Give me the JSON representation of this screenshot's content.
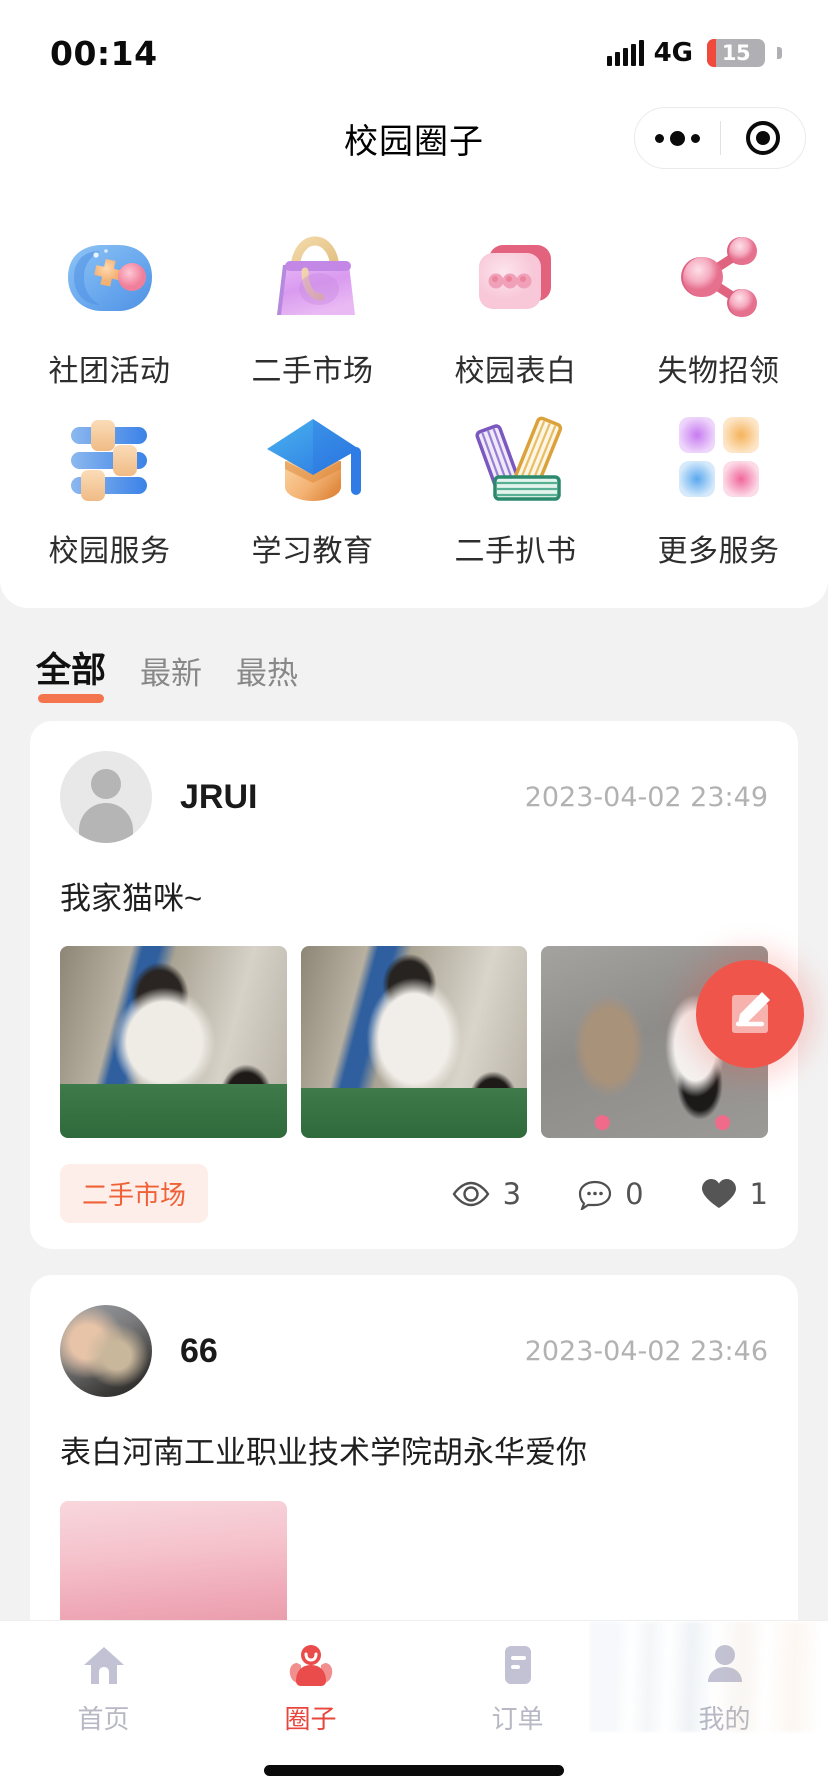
{
  "status_bar": {
    "time": "00:14",
    "network": "4G",
    "battery_level": "15",
    "signal_icon": "signal-bars-icon",
    "battery_icon": "battery-icon"
  },
  "nav": {
    "title": "校园圈子",
    "more_icon": "more-dots-icon",
    "target_icon": "target-circle-icon"
  },
  "grid": {
    "rows": [
      [
        {
          "label": "社团活动",
          "icon": "gamepad-icon"
        },
        {
          "label": "二手市场",
          "icon": "handbag-icon"
        },
        {
          "label": "校园表白",
          "icon": "chat-bubble-icon"
        },
        {
          "label": "失物招领",
          "icon": "share-nodes-icon"
        }
      ],
      [
        {
          "label": "校园服务",
          "icon": "sliders-icon"
        },
        {
          "label": "学习教育",
          "icon": "graduation-cap-icon"
        },
        {
          "label": "二手扒书",
          "icon": "books-icon"
        },
        {
          "label": "更多服务",
          "icon": "grid-squares-icon"
        }
      ]
    ]
  },
  "filter_tabs": [
    {
      "label": "全部",
      "active": true
    },
    {
      "label": "最新",
      "active": false
    },
    {
      "label": "最热",
      "active": false
    }
  ],
  "fab": {
    "icon": "compose-edit-icon",
    "color": "#f0554c"
  },
  "feed": {
    "posts": [
      {
        "username": "JRUI",
        "timestamp": "2023-04-02 23:49",
        "avatar_type": "default-avatar",
        "text": "我家猫咪~",
        "category": "二手市场",
        "views": "3",
        "comments": "0",
        "likes": "1",
        "images": [
          "cat-photo-1",
          "cat-photo-2",
          "cat-photo-3"
        ]
      },
      {
        "username": "66",
        "timestamp": "2023-04-02 23:46",
        "avatar_type": "photo-avatar",
        "text": "表白河南工业职业技术学院胡永华爱你",
        "images": [
          "pink-landscape-photo"
        ]
      }
    ],
    "view_icon": "eye-icon",
    "comment_icon": "comment-bubble-icon",
    "like_icon": "heart-icon"
  },
  "tabbar": {
    "items": [
      {
        "label": "首页",
        "icon": "home-icon",
        "active": false
      },
      {
        "label": "圈子",
        "icon": "people-circle-icon",
        "active": true
      },
      {
        "label": "订单",
        "icon": "order-list-icon",
        "active": false
      },
      {
        "label": "我的",
        "icon": "person-icon",
        "active": false
      }
    ],
    "active_color": "#e8453c",
    "inactive_color": "#b8b8c4"
  }
}
